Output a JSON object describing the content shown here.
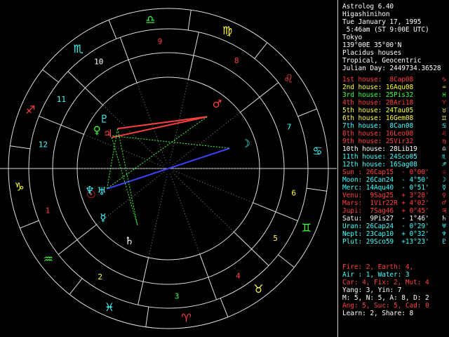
{
  "header": {
    "app": "Astrolog 6.40",
    "name": "Higashinihon",
    "date": "Tue January 17, 1995",
    "time": " 5:46am (ST 9:00E UTC)",
    "place": "Tokyo",
    "coords": "139°00E 35°00'N",
    "system": "Placidus houses",
    "zodiac": "Tropical, Geocentric",
    "julian": "Julian Day: 2449734.36528"
  },
  "houses": [
    {
      "text": "1st house:  8Cap08",
      "color": "#ff4040",
      "glyph": "♑"
    },
    {
      "text": "2nd house: 16Aqu08",
      "color": "#ffff40",
      "glyph": "♒"
    },
    {
      "text": "3rd house: 25Pis32",
      "color": "#40ff40",
      "glyph": "♓"
    },
    {
      "text": "4th house: 28Ari18",
      "color": "#ff4040",
      "glyph": "♈"
    },
    {
      "text": "5th house: 24Tau05",
      "color": "#ffff40",
      "glyph": "♉"
    },
    {
      "text": "6th house: 16Gem08",
      "color": "#ffff40",
      "glyph": "♊"
    },
    {
      "text": "7th house:  8Can08",
      "color": "#40ffff",
      "glyph": "♋"
    },
    {
      "text": "8th house: 16Leo08",
      "color": "#ff4040",
      "glyph": "♌"
    },
    {
      "text": "9th house: 25Vir32",
      "color": "#ff4040",
      "glyph": "♍"
    },
    {
      "text": "10th house: 28Lib19",
      "color": "#ffffff",
      "glyph": "♎"
    },
    {
      "text": "11th house: 24Sco05",
      "color": "#40ffff",
      "glyph": "♏"
    },
    {
      "text": "12th house: 16Sag08",
      "color": "#40ffff",
      "glyph": "♐"
    }
  ],
  "planets": [
    {
      "text": "Sun : 26Cap15  - 0°00'",
      "color": "#ff4040",
      "glyph": "☉"
    },
    {
      "text": "Moon: 26Can24  - 4°50'",
      "color": "#40ffff",
      "glyph": "☽"
    },
    {
      "text": "Merc: 14Aqu40  - 0°51'",
      "color": "#40ffff",
      "glyph": "☿"
    },
    {
      "text": "Venu:  9Sag25  + 3°28'",
      "color": "#ff4040",
      "glyph": "♀"
    },
    {
      "text": "Mars:  1Vir22R + 4°02'",
      "color": "#ff4040",
      "glyph": "♂"
    },
    {
      "text": "Jupi:  7Sag46  + 0°45'",
      "color": "#ff4040",
      "glyph": "♃"
    },
    {
      "text": "Satu:  9Pis27  - 1°46'",
      "color": "#ffffff",
      "glyph": "♄"
    },
    {
      "text": "Uran: 26Cap24  - 0°29'",
      "color": "#40ffff",
      "glyph": "♅"
    },
    {
      "text": "Nept: 23Cap10  + 0°32'",
      "color": "#40ffff",
      "glyph": "♆"
    },
    {
      "text": "Plut: 29Sco59  +13°23'",
      "color": "#40ffff",
      "glyph": "♇"
    }
  ],
  "stats": [
    {
      "text": "Fire: 2, Earth: 4,",
      "color": "#ff4040"
    },
    {
      "text": "Air : 1, Water: 3",
      "color": "#40ffff"
    },
    {
      "text": "Car: 4, Fix: 2, Mut: 4",
      "color": "#ff4040"
    },
    {
      "text": "Yang: 3, Yin: 7",
      "color": "#ffffff"
    },
    {
      "text": "M: 5, N: 5, A: 8, D: 2",
      "color": "#ffffff"
    },
    {
      "text": "Ang: 5, Suc: 5, Cad: 0",
      "color": "#ff4040"
    },
    {
      "text": "Learn: 2, Share: 8",
      "color": "#ffffff"
    }
  ],
  "wheel": {
    "house_numbers": [
      "1",
      "2",
      "3",
      "4",
      "5",
      "6",
      "7",
      "8",
      "9",
      "10",
      "11",
      "12"
    ],
    "sign_glyphs": [
      "♈",
      "♉",
      "♊",
      "♋",
      "♌",
      "♍",
      "♎",
      "♏",
      "♐",
      "♑",
      "♒",
      "♓"
    ],
    "colors": {
      "fire": "#ff4040",
      "earth": "#ffff40",
      "air": "#40ff40",
      "water": "#40ffff",
      "ring": "#dddddd",
      "conj": "#ffff40",
      "opp": "#4040ff",
      "square": "#ff4040",
      "trine": "#40ff40"
    }
  }
}
